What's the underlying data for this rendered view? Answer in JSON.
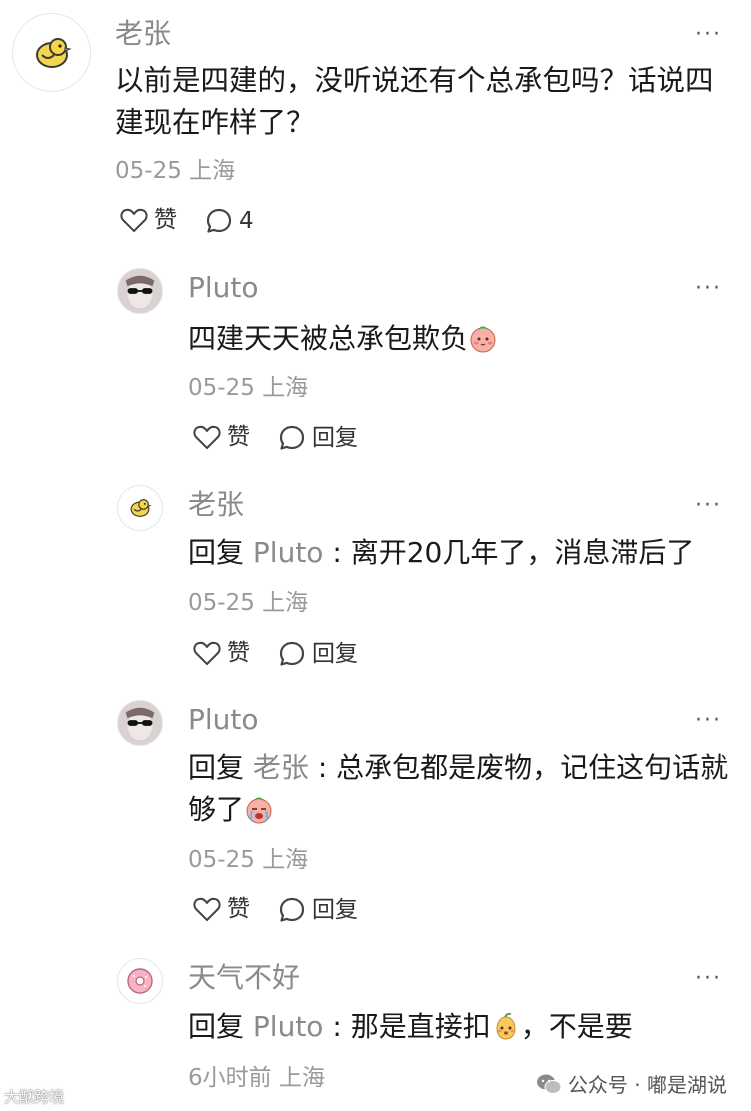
{
  "comment": {
    "author": "老张",
    "text": "以前是四建的，没听说还有个总承包吗？话说四建现在咋样了？",
    "meta": "05-25 上海",
    "like_label": "赞",
    "reply_count": "4"
  },
  "replies": [
    {
      "author": "Pluto",
      "text": "四建天天被总承包欺负",
      "meta": "05-25 上海",
      "like_label": "赞",
      "reply_label": "回复"
    },
    {
      "author": "老张",
      "prefix": "回复",
      "target": "Pluto",
      "separator": " : ",
      "text": "离开20几年了，消息滞后了",
      "meta": "05-25 上海",
      "like_label": "赞",
      "reply_label": "回复"
    },
    {
      "author": "Pluto",
      "prefix": "回复",
      "target": "老张",
      "separator": " : ",
      "text": "总承包都是废物，记住这句话就够了",
      "meta": "05-25 上海",
      "like_label": "赞",
      "reply_label": "回复"
    },
    {
      "author": "天气不好",
      "prefix": "回复",
      "target": "Pluto",
      "separator": " : ",
      "text_before": "那是直接扣",
      "text_after": "，不是要",
      "meta": "6小时前 上海"
    }
  ],
  "more_label": "···",
  "watermark": {
    "left": "大猷跨境",
    "right": "公众号 · 嘟是湖说"
  },
  "colors": {
    "name_gray": "#8a8a8a",
    "meta_gray": "#9a9a9a",
    "text": "#1a1a1a"
  }
}
